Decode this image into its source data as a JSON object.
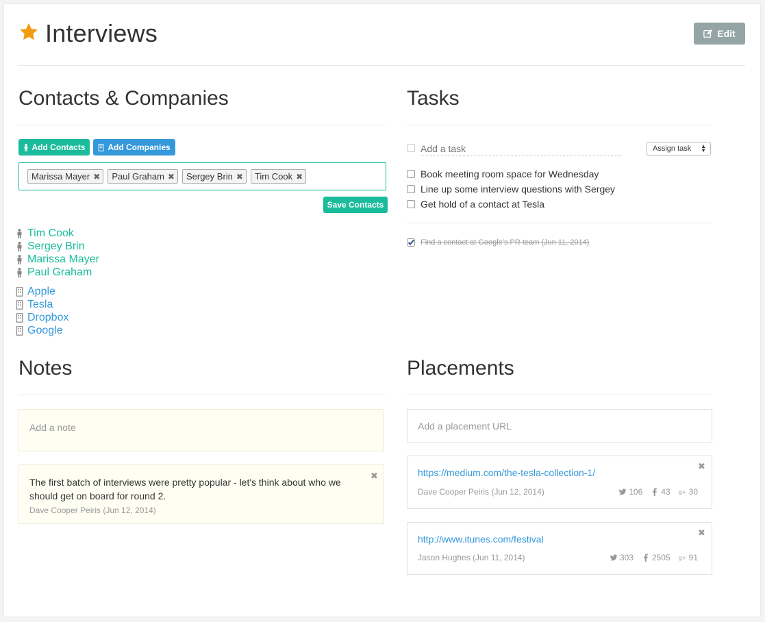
{
  "header": {
    "title": "Interviews",
    "edit_label": "Edit",
    "star_color": "#f39c12"
  },
  "contacts_section": {
    "title": "Contacts & Companies",
    "add_contacts_label": "Add Contacts",
    "add_companies_label": "Add Companies",
    "save_contacts_label": "Save Contacts",
    "tags": [
      "Marissa Mayer",
      "Paul Graham",
      "Sergey Brin",
      "Tim Cook"
    ],
    "contacts": [
      "Tim Cook",
      "Sergey Brin",
      "Marissa Mayer",
      "Paul Graham"
    ],
    "companies": [
      "Apple",
      "Tesla",
      "Dropbox",
      "Google"
    ],
    "contact_color": "#1abc9c",
    "company_color": "#3498db"
  },
  "tasks_section": {
    "title": "Tasks",
    "add_task_placeholder": "Add a task",
    "assign_label": "Assign task",
    "open_tasks": [
      "Book meeting room space for Wednesday",
      "Line up some interview questions with Sergey",
      "Get hold of a contact at Tesla"
    ],
    "completed_tasks": [
      "Find a contact at Google's PR team (Jun 11, 2014)"
    ]
  },
  "notes_section": {
    "title": "Notes",
    "add_note_placeholder": "Add a note",
    "notes": [
      {
        "text": "The first batch of interviews were pretty popular - let's think about who we should get on board for round 2.",
        "meta": "Dave Cooper Peiris (Jun 12, 2014)"
      }
    ]
  },
  "placements_section": {
    "title": "Placements",
    "add_placement_placeholder": "Add a placement URL",
    "placements": [
      {
        "url": "https://medium.com/the-tesla-collection-1/",
        "meta": "Dave Cooper Peiris (Jun 12, 2014)",
        "twitter": "106",
        "facebook": "43",
        "gplus": "30"
      },
      {
        "url": "http://www.itunes.com/festival",
        "meta": "Jason Hughes (Jun 11, 2014)",
        "twitter": "303",
        "facebook": "2505",
        "gplus": "91"
      }
    ]
  }
}
